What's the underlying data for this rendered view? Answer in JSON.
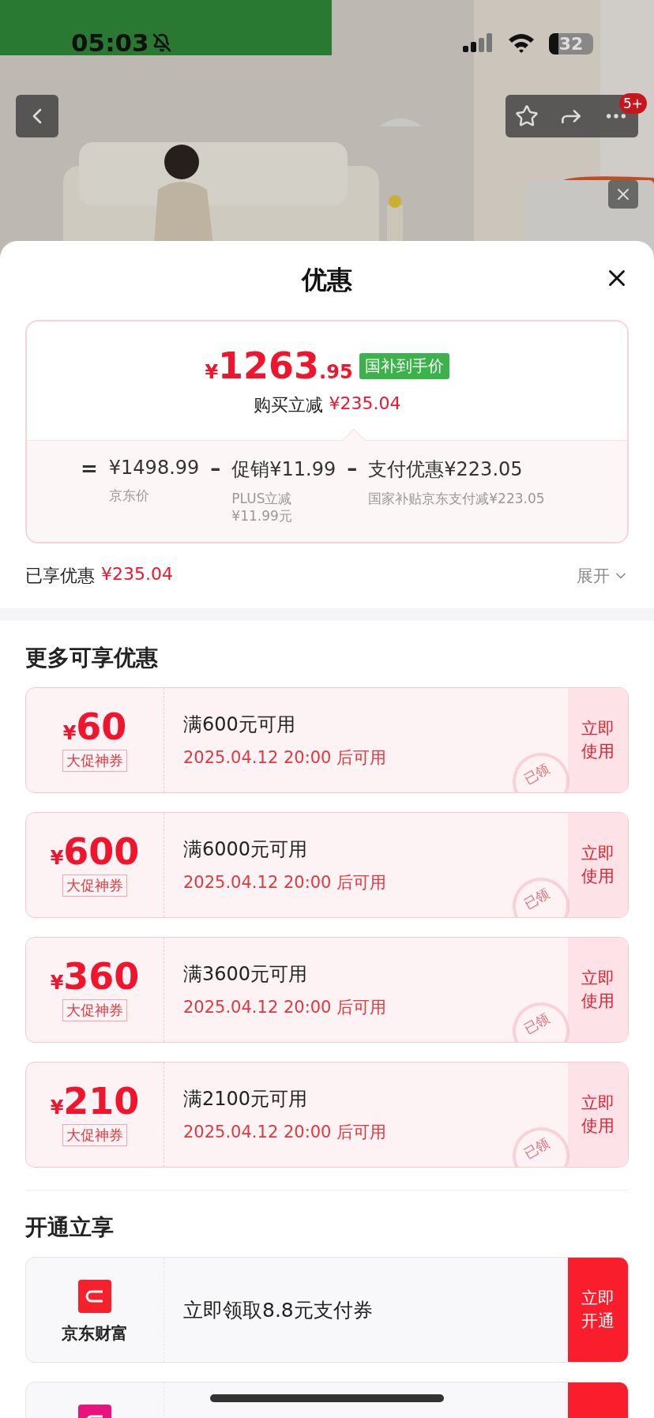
{
  "status_bar": {
    "time": "05:03",
    "battery": "32"
  },
  "nav": {
    "badge": "5+"
  },
  "sheet": {
    "title": "优惠"
  },
  "price_card": {
    "currency": "¥",
    "integer": "1263",
    "decimal": ".95",
    "badge": "国补到手价",
    "saving_label": "购买立减",
    "saving_amount": "¥235.04",
    "breakdown": [
      {
        "operator": "=",
        "value": "¥1498.99",
        "note": "京东价"
      },
      {
        "operator": "–",
        "value": "促销¥11.99",
        "note": "PLUS立减\n¥11.99元"
      },
      {
        "operator": "–",
        "value": "支付优惠¥223.05",
        "note": "国家补贴京东支付减¥223.05"
      }
    ]
  },
  "summary": {
    "label": "已享优惠",
    "amount": "¥235.04",
    "toggle": "展开"
  },
  "coupons_section": {
    "title": "更多可享优惠",
    "coupons": [
      {
        "currency": "¥",
        "amount": "60",
        "tag": "大促神券",
        "condition": "满600元可用",
        "valid": "2025.04.12 20:00 后可用",
        "button": "立即使用",
        "stamp": "已领"
      },
      {
        "currency": "¥",
        "amount": "600",
        "tag": "大促神券",
        "condition": "满6000元可用",
        "valid": "2025.04.12 20:00 后可用",
        "button": "立即使用",
        "stamp": "已领"
      },
      {
        "currency": "¥",
        "amount": "360",
        "tag": "大促神券",
        "condition": "满3600元可用",
        "valid": "2025.04.12 20:00 后可用",
        "button": "立即使用",
        "stamp": "已领"
      },
      {
        "currency": "¥",
        "amount": "210",
        "tag": "大促神券",
        "condition": "满2100元可用",
        "valid": "2025.04.12 20:00 后可用",
        "button": "立即使用",
        "stamp": "已领"
      }
    ]
  },
  "services_section": {
    "title": "开通立享",
    "services": [
      {
        "color": "#f5222d",
        "name": "京东财富",
        "offer": "立即领取8.8元支付券",
        "button": "立即开通"
      },
      {
        "color": "#e8137c"
      }
    ]
  }
}
